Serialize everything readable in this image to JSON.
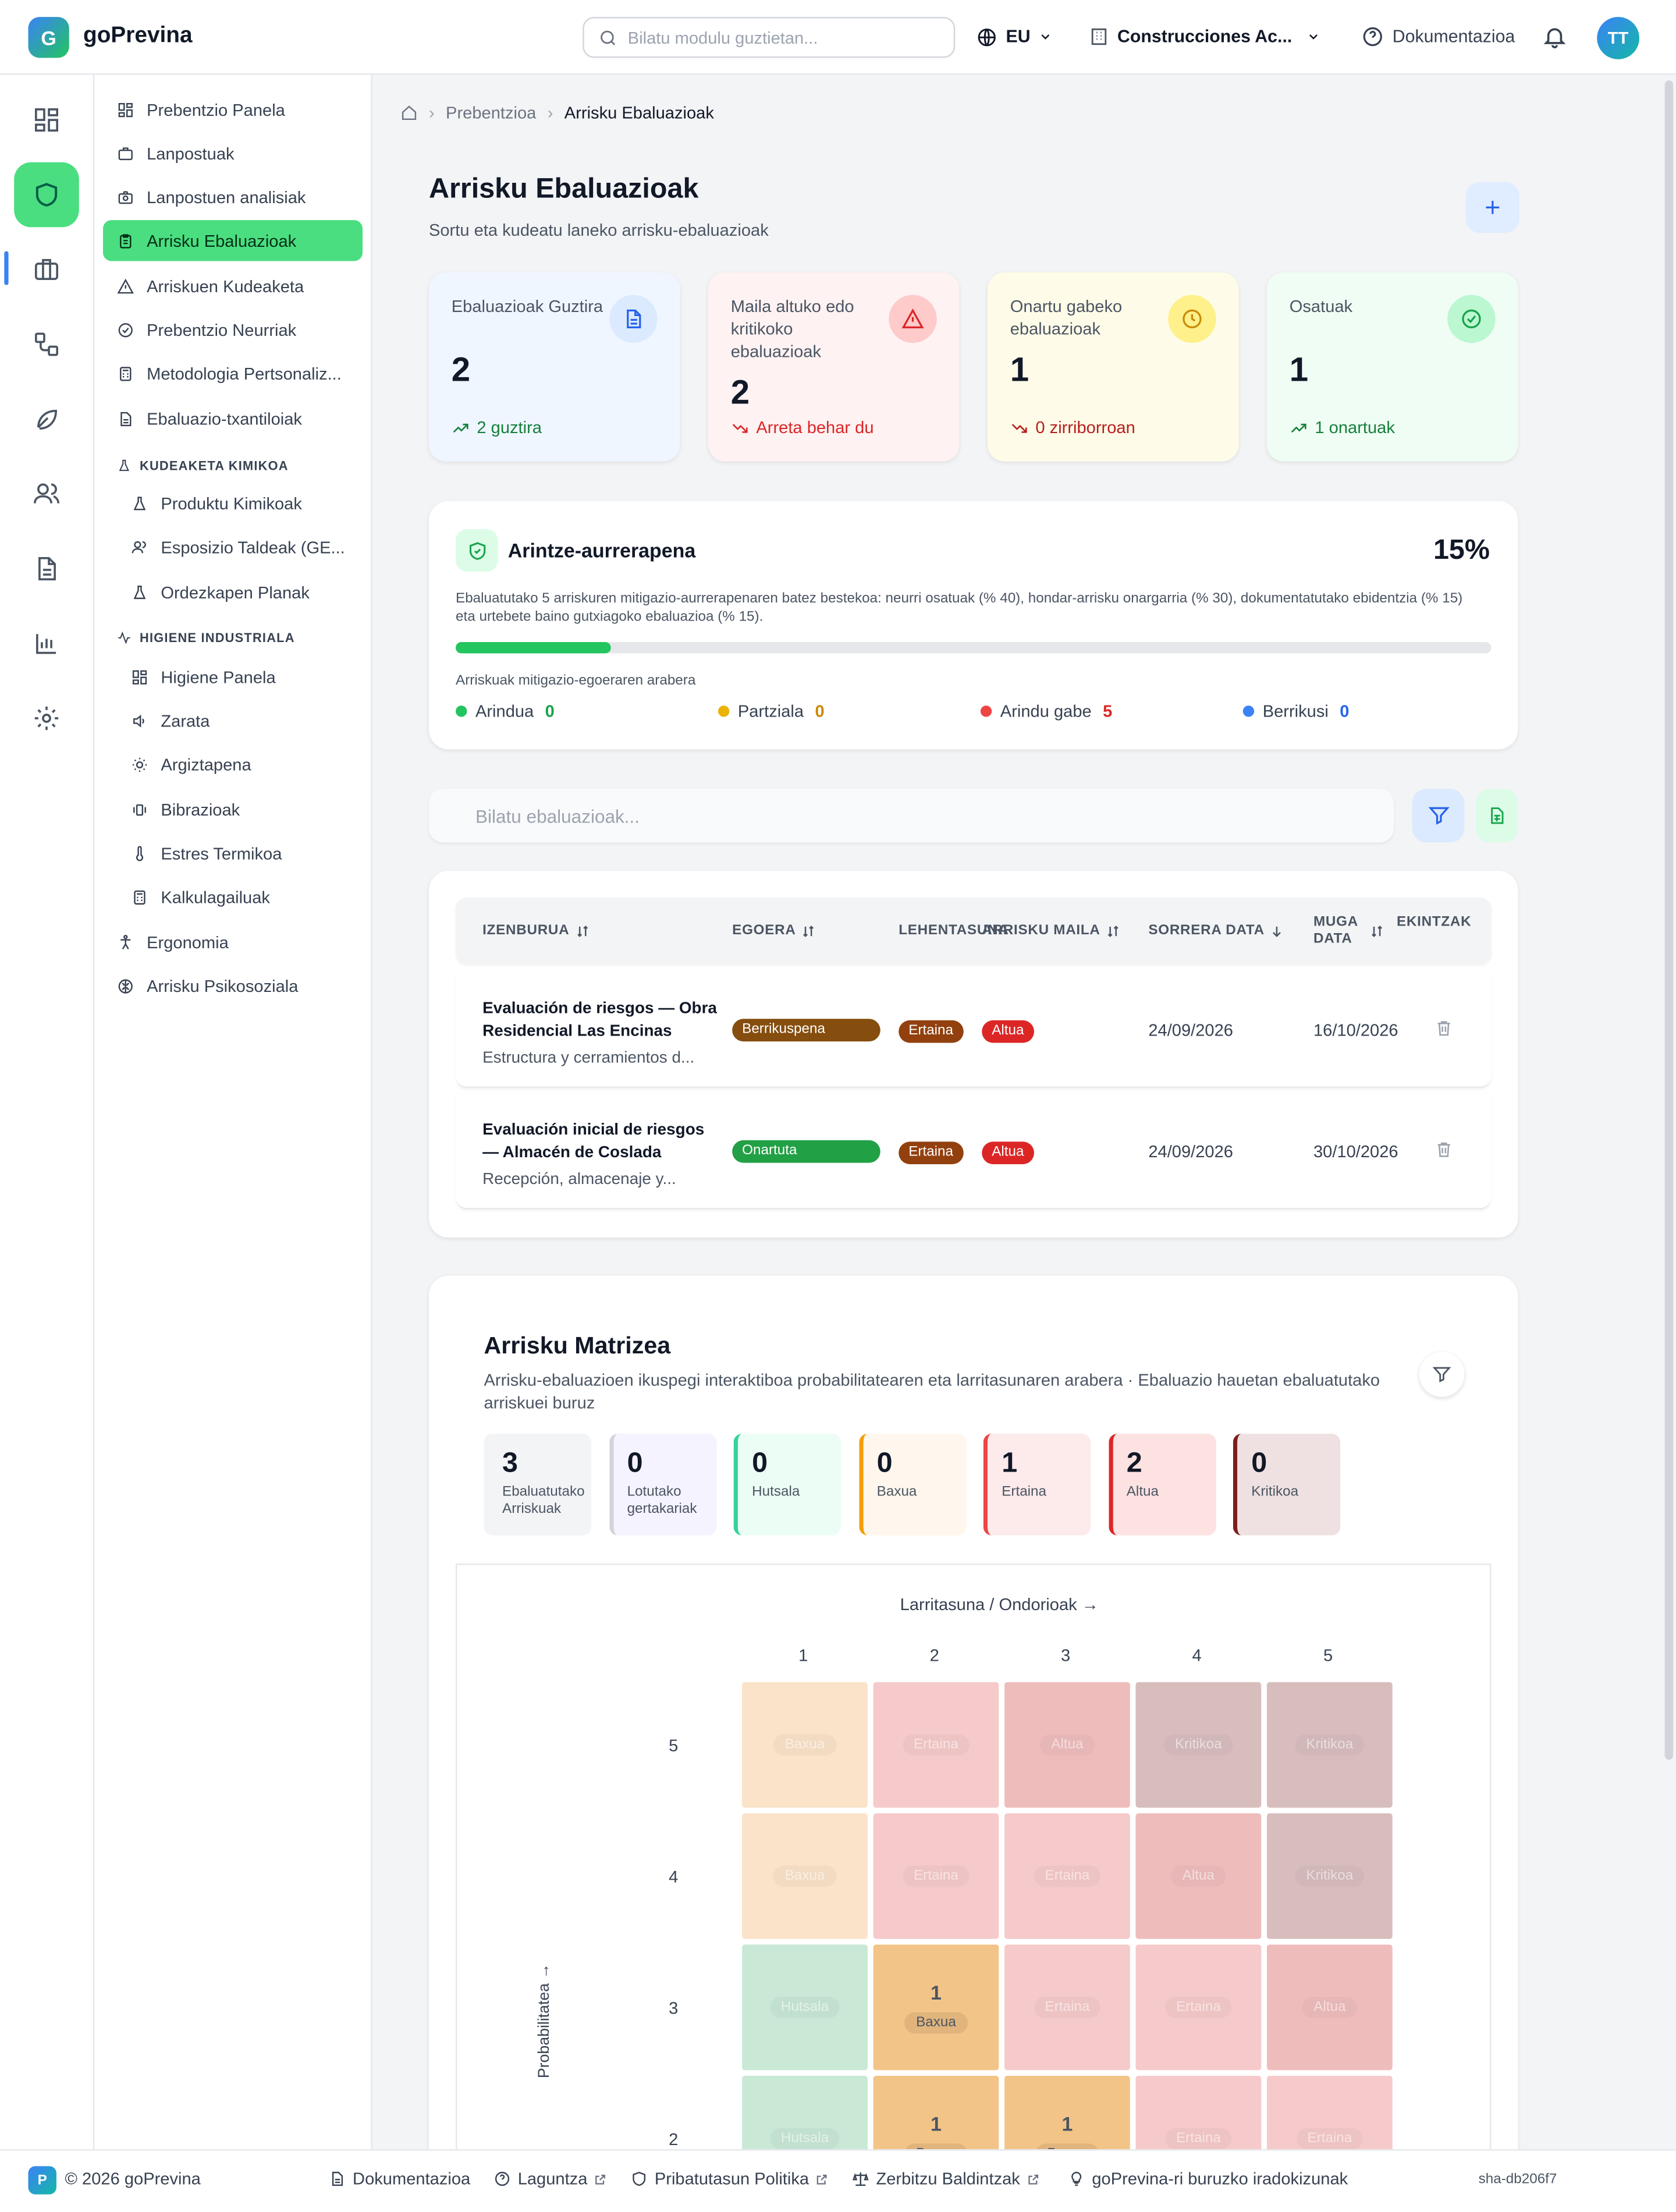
{
  "app": {
    "logo_letter": "G",
    "name": "goPrevina"
  },
  "header": {
    "search_placeholder": "Bilatu modulu guztietan...",
    "language": "EU",
    "company": "Construcciones Ac...",
    "docs": "Dokumentazioa",
    "avatar": "TT"
  },
  "rail": {
    "icons": [
      "dashboard-icon",
      "shield-icon",
      "briefcase-icon",
      "workflow-icon",
      "leaf-icon",
      "users-icon",
      "document-icon",
      "bar-chart-icon",
      "settings-icon"
    ],
    "active": "shield-icon"
  },
  "sidebar": {
    "items": [
      {
        "label": "Prebentzio Panela",
        "icon": "grid-icon"
      },
      {
        "label": "Lanpostuak",
        "icon": "briefcase-icon"
      },
      {
        "label": "Lanpostuen analisiak",
        "icon": "camera-icon"
      },
      {
        "label": "Arrisku Ebaluazioak",
        "icon": "clipboard-icon",
        "active": true
      },
      {
        "label": "Arriskuen Kudeaketa",
        "icon": "warning-icon"
      },
      {
        "label": "Prebentzio Neurriak",
        "icon": "check-circle-icon"
      },
      {
        "label": "Metodologia Pertsonaliz...",
        "icon": "calculator-icon"
      },
      {
        "label": "Ebaluazio-txantiloiak",
        "icon": "file-icon"
      }
    ],
    "chemical": {
      "section": "KUDEAKETA KIMIKOA",
      "items": [
        {
          "label": "Produktu Kimikoak",
          "icon": "flask-icon"
        },
        {
          "label": "Esposizio Taldeak (GE...",
          "icon": "users-icon"
        },
        {
          "label": "Ordezkapen Planak",
          "icon": "flask-icon"
        }
      ]
    },
    "hygiene": {
      "section": "HIGIENE INDUSTRIALA",
      "items": [
        {
          "label": "Higiene Panela",
          "icon": "grid-icon"
        },
        {
          "label": "Zarata",
          "icon": "volume-icon"
        },
        {
          "label": "Argiztapena",
          "icon": "sun-icon"
        },
        {
          "label": "Bibrazioak",
          "icon": "vibration-icon"
        },
        {
          "label": "Estres Termikoa",
          "icon": "thermometer-icon"
        },
        {
          "label": "Kalkulagailuak",
          "icon": "calculator-icon"
        }
      ]
    },
    "bottom": [
      {
        "label": "Ergonomia",
        "icon": "person-icon"
      },
      {
        "label": "Arrisku Psikosoziala",
        "icon": "brain-icon"
      }
    ]
  },
  "breadcrumb": {
    "home_icon": "home-icon",
    "parent": "Prebentzioa",
    "current": "Arrisku Ebaluazioak"
  },
  "page": {
    "title": "Arrisku Ebaluazioak",
    "subtitle": "Sortu eta kudeatu laneko arrisku-ebaluazioak"
  },
  "stats": [
    {
      "label": "Ebaluazioak Guztira",
      "value": "2",
      "footer": "2 guztira",
      "color": "#eff6ff",
      "accent": "#2563eb",
      "foot_color": "#15803d",
      "icon": "document-icon"
    },
    {
      "label": "Maila altuko edo kritikoko ebaluazioak",
      "value": "2",
      "footer": "Arreta behar du",
      "color": "#fef2f2",
      "accent": "#dc2626",
      "foot_color": "#dc2626",
      "icon": "alert-triangle-icon"
    },
    {
      "label": "Onartu gabeko ebaluazioak",
      "value": "1",
      "footer": "0 zirriborroan",
      "color": "#fefce8",
      "accent": "#ca8a04",
      "foot_color": "#b91c1c",
      "icon": "clock-icon"
    },
    {
      "label": "Osatuak",
      "value": "1",
      "footer": "1 onartuak",
      "color": "#f0fdf4",
      "accent": "#16a34a",
      "foot_color": "#15803d",
      "icon": "check-circle-icon"
    }
  ],
  "mitigation": {
    "title": "Arintze-aurrerapena",
    "percent": "15%",
    "progress": 0.15,
    "description": "Ebaluatutako 5 arriskuren mitigazio-aurrerapenaren batez bestekoa: neurri osatuak (% 40), hondar-arrisku onargarria (% 30), dokumentatutako ebidentzia (% 15) eta urtebete baino gutxiagoko ebaluazioa (% 15).",
    "legend_title": "Arriskuak mitigazio-egoeraren arabera",
    "legend": [
      {
        "label": "Arindua",
        "value": "0",
        "color": "#22c55e"
      },
      {
        "label": "Partziala",
        "value": "0",
        "color": "#eab308"
      },
      {
        "label": "Arindu gabe",
        "value": "5",
        "color": "#ef4444"
      },
      {
        "label": "Berrikusi",
        "value": "0",
        "color": "#3b82f6"
      }
    ]
  },
  "filter": {
    "placeholder": "Bilatu ebaluazioak..."
  },
  "table": {
    "headers": [
      "IZENBURUA",
      "EGOERA",
      "LEHENTASUNA",
      "ARRISKU MAILA",
      "SORRERA DATA",
      "MUGA DATA",
      "EKINTZAK"
    ],
    "rows": [
      {
        "title": "Evaluación de riesgos — Obra Residencial Las Encinas",
        "desc": "Estructura y cerramientos d...",
        "status": "Berrikuspena",
        "status_color": "#854d0e",
        "priority": "Ertaina",
        "risk": "Altua",
        "created": "24/09/2026",
        "due": "16/10/2026"
      },
      {
        "title": "Evaluación inicial de riesgos — Almacén de Coslada",
        "desc": "Recepción, almacenaje y...",
        "status": "Onartuta",
        "status_color": "#22a045",
        "priority": "Ertaina",
        "risk": "Altua",
        "created": "24/09/2026",
        "due": "30/10/2026"
      }
    ]
  },
  "matrix": {
    "title": "Arrisku Matrizea",
    "subtitle": "Arrisku-ebaluazioen ikuspegi interaktiboa probabilitatearen eta larritasunaren arabera · Ebaluazio hauetan ebaluatutako arriskuei buruz",
    "stats": [
      {
        "value": "3",
        "label": "Ebaluatutako Arriskuak",
        "bg": "#f3f4f6",
        "border": "#f3f4f6"
      },
      {
        "value": "0",
        "label": "Lotutako gertakariak",
        "bg": "#f5f3ff",
        "border": "#d1d5db"
      },
      {
        "value": "0",
        "label": "Hutsala",
        "bg": "#ecfdf5",
        "border": "#34d399"
      },
      {
        "value": "0",
        "label": "Baxua",
        "bg": "#fff7ed",
        "border": "#f59e0b"
      },
      {
        "value": "1",
        "label": "Ertaina",
        "bg": "#fdeaea",
        "border": "#ef4444"
      },
      {
        "value": "2",
        "label": "Altua",
        "bg": "#fde2e2",
        "border": "#dc2626"
      },
      {
        "value": "0",
        "label": "Kritikoa",
        "bg": "#efe1e1",
        "border": "#7f1d1d"
      }
    ],
    "x_label": "Larritasuna / Ondorioak →",
    "y_label": "Probabilitatea →",
    "x_ticks": [
      "1",
      "2",
      "3",
      "4",
      "5"
    ],
    "y_ticks": [
      "5",
      "4",
      "3",
      "2"
    ],
    "level_colors": {
      "Hutsala": "#c9e8d6",
      "Baxua": "#fae3c8",
      "Ertaina": "#f6caca",
      "Altua": "#efbcbc",
      "Kritikoa": "#d8bdbd"
    },
    "rows": [
      [
        {
          "level": "Baxua"
        },
        {
          "level": "Ertaina"
        },
        {
          "level": "Altua"
        },
        {
          "level": "Kritikoa"
        },
        {
          "level": "Kritikoa"
        }
      ],
      [
        {
          "level": "Baxua"
        },
        {
          "level": "Ertaina"
        },
        {
          "level": "Ertaina"
        },
        {
          "level": "Altua"
        },
        {
          "level": "Kritikoa"
        }
      ],
      [
        {
          "level": "Hutsala"
        },
        {
          "level": "Baxua",
          "count": "1"
        },
        {
          "level": "Ertaina"
        },
        {
          "level": "Ertaina"
        },
        {
          "level": "Altua"
        }
      ],
      [
        {
          "level": "Hutsala"
        },
        {
          "level": "Baxua",
          "count": "1"
        },
        {
          "level": "Baxua",
          "count": "1"
        },
        {
          "level": "Ertaina"
        },
        {
          "level": "Ertaina"
        }
      ]
    ]
  },
  "footer": {
    "logo": "P",
    "copyright": "© 2026 goPrevina",
    "links": [
      "Dokumentazioa",
      "Laguntza",
      "Pribatutasun Politika",
      "Zerbitzu Baldintzak",
      "goPrevina-ri buruzko iradokizunak"
    ],
    "version": "sha-db206f7"
  }
}
